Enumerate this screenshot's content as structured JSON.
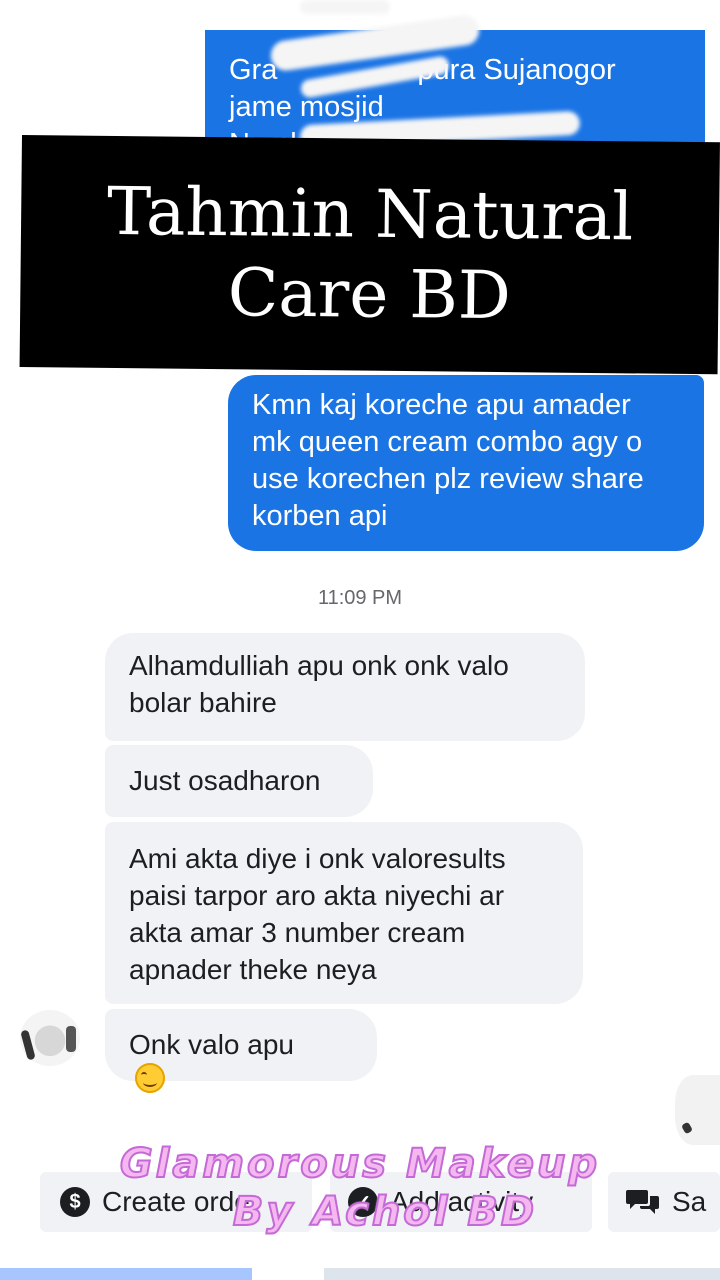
{
  "outgoing_top": {
    "line1": "Gra",
    "line1_b": "pura Sujanogor",
    "line2": "jame mosjid",
    "line3": "Numb"
  },
  "banner": {
    "line1": "Tahmin Natural",
    "line2": "Care BD"
  },
  "outgoing_review": {
    "lines": [
      "Kmn kaj koreche apu amader",
      "mk queen cream combo agy o",
      "use korechen plz review share",
      "korben api"
    ]
  },
  "timestamp": "11:09 PM",
  "incoming": [
    {
      "lines": [
        "Alhamdulliah apu onk onk valo",
        "bolar bahire"
      ]
    },
    {
      "lines": [
        "Just osadharon"
      ]
    },
    {
      "lines": [
        "Ami akta diye i onk valoresults",
        "paisi tarpor aro akta niyechi ar",
        "akta amar 3 number cream",
        "apnader theke neya"
      ]
    },
    {
      "lines": [
        "Onk valo apu"
      ],
      "emoji": "smiling-face"
    }
  ],
  "actions": {
    "create_order": "Create order",
    "add_activity": "Add activity",
    "saved": "Sa",
    "create_order_icon": "$"
  },
  "watermark": {
    "line1": "Glamorous Makeup",
    "line2": "By Achol BD"
  },
  "colors": {
    "outgoing_bubble": "#1b74e4",
    "incoming_bubble": "#f0f2f5",
    "banner_bg": "#000000",
    "watermark": "#f4b7ef"
  }
}
